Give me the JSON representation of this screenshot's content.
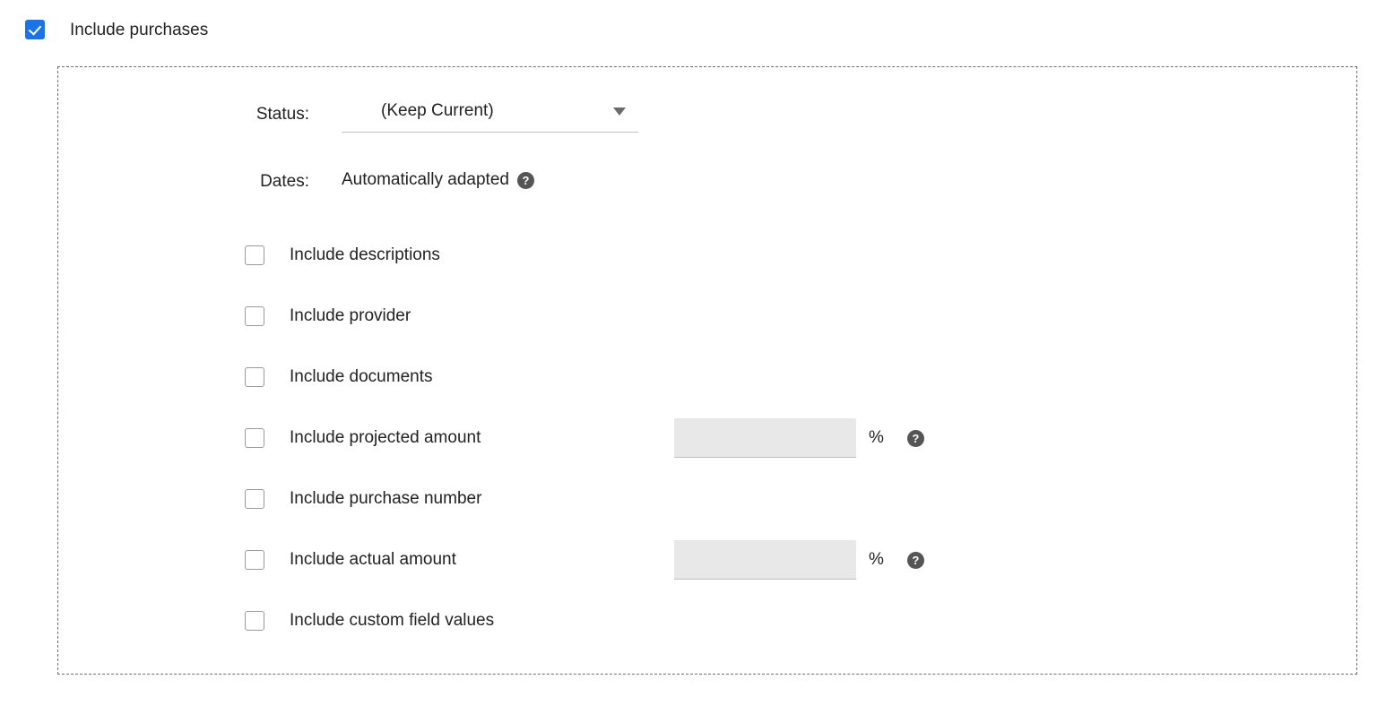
{
  "master": {
    "label": "Include purchases",
    "checked": true,
    "accent_color": "#1a73e8"
  },
  "panel": {
    "border_color": "#6e6e6e",
    "border_style": "dashed"
  },
  "fields": {
    "status": {
      "label": "Status:",
      "value": "(Keep Current)",
      "caret_icon": "chevron-down-icon",
      "options": [
        "(Keep Current)"
      ]
    },
    "dates": {
      "label": "Dates:",
      "value": "Automatically adapted",
      "help_icon": "help-circle-icon",
      "help_glyph": "?"
    }
  },
  "options": [
    {
      "label": "Include descriptions",
      "checked": false,
      "name": "include-descriptions",
      "has_percent": false
    },
    {
      "label": "Include provider",
      "checked": false,
      "name": "include-provider",
      "has_percent": false
    },
    {
      "label": "Include documents",
      "checked": false,
      "name": "include-documents",
      "has_percent": false
    },
    {
      "label": "Include projected amount",
      "checked": false,
      "name": "include-projected-amount",
      "has_percent": true,
      "percent_value": "",
      "percent_placeholder": "",
      "percent_sign": "%",
      "help_icon": "help-circle-icon",
      "help_glyph": "?"
    },
    {
      "label": "Include purchase number",
      "checked": false,
      "name": "include-purchase-number",
      "has_percent": false
    },
    {
      "label": "Include actual amount",
      "checked": false,
      "name": "include-actual-amount",
      "has_percent": true,
      "percent_value": "",
      "percent_placeholder": "",
      "percent_sign": "%",
      "help_icon": "help-circle-icon",
      "help_glyph": "?"
    },
    {
      "label": "Include custom field values",
      "checked": false,
      "name": "include-custom-field-values",
      "has_percent": false
    }
  ],
  "colors": {
    "text": "#222222",
    "input_background": "#e8e8e8",
    "input_underline": "#bdbdbd",
    "checkbox_border": "#9a9a9a",
    "help_background": "#555555",
    "select_underline": "#c3c3c3"
  }
}
